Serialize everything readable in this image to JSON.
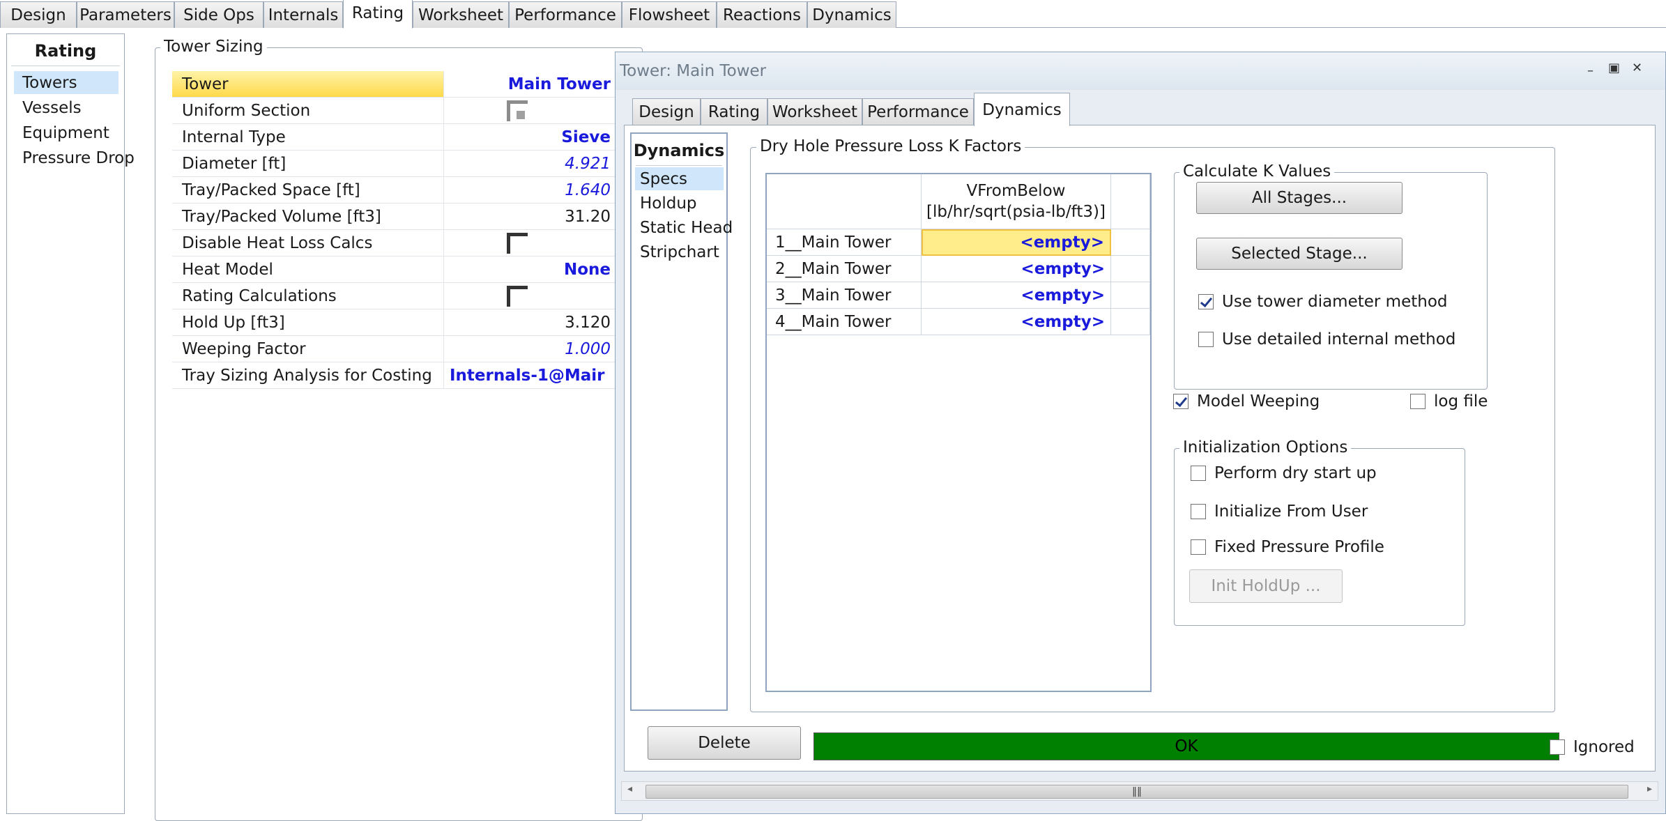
{
  "top_tabs": [
    "Design",
    "Parameters",
    "Side Ops",
    "Internals",
    "Rating",
    "Worksheet",
    "Performance",
    "Flowsheet",
    "Reactions",
    "Dynamics"
  ],
  "active_top_tab": "Rating",
  "left_nav": {
    "title": "Rating",
    "items": [
      "Towers",
      "Vessels",
      "Equipment",
      "Pressure Drop"
    ],
    "selected": "Towers"
  },
  "tower_sizing": {
    "title": "Tower Sizing",
    "rows": [
      {
        "label": "Tower",
        "value": "Main Tower"
      },
      {
        "label": "Uniform Section",
        "value": ""
      },
      {
        "label": "Internal Type",
        "value": "Sieve"
      },
      {
        "label": "Diameter [ft]",
        "value": "4.921"
      },
      {
        "label": "Tray/Packed Space [ft]",
        "value": "1.640"
      },
      {
        "label": "Tray/Packed Volume [ft3]",
        "value": "31.20"
      },
      {
        "label": "Disable Heat Loss Calcs",
        "value": ""
      },
      {
        "label": "Heat Model",
        "value": "None"
      },
      {
        "label": "Rating Calculations",
        "value": ""
      },
      {
        "label": "Hold Up [ft3]",
        "value": "3.120"
      },
      {
        "label": "Weeping Factor",
        "value": "1.000"
      },
      {
        "label": "Tray Sizing Analysis for Costing",
        "value": "Internals-1@Mair"
      }
    ]
  },
  "subwindow": {
    "title": "Tower: Main Tower",
    "tabs": [
      "Design",
      "Rating",
      "Worksheet",
      "Performance",
      "Dynamics"
    ],
    "active_tab": "Dynamics",
    "dyn_nav": {
      "title": "Dynamics",
      "items": [
        "Specs",
        "Holdup",
        "Static Head",
        "Stripchart"
      ],
      "selected": "Specs"
    },
    "kfactors": {
      "group_title": "Dry Hole Pressure Loss K Factors",
      "column_header_line1": "VFromBelow",
      "column_header_line2": "[lb/hr/sqrt(psia-lb/ft3)]",
      "rows": [
        {
          "stage": "1__Main Tower",
          "value": "<empty>"
        },
        {
          "stage": "2__Main Tower",
          "value": "<empty>"
        },
        {
          "stage": "3__Main Tower",
          "value": "<empty>"
        },
        {
          "stage": "4__Main Tower",
          "value": "<empty>"
        }
      ]
    },
    "calc_k": {
      "title": "Calculate K Values",
      "all_stages_label": "All Stages...",
      "selected_stage_label": "Selected Stage...",
      "use_tower_diameter_label": "Use tower diameter method",
      "use_tower_diameter_checked": true,
      "use_detailed_internal_label": "Use detailed internal method",
      "use_detailed_internal_checked": false
    },
    "model_weeping_label": "Model Weeping",
    "model_weeping_checked": true,
    "log_file_label": "log file",
    "log_file_checked": false,
    "init_options": {
      "title": "Initialization Options",
      "perform_dry_label": "Perform dry start up",
      "init_from_user_label": "Initialize From User",
      "fixed_pressure_label": "Fixed Pressure Profile",
      "init_holdup_label": "Init HoldUp ..."
    },
    "delete_label": "Delete",
    "status_text": "OK",
    "ignored_label": "Ignored",
    "ignored_checked": false
  },
  "colors": {
    "status_green": "#008000",
    "highlight_yellow": "#ffd94a",
    "value_blue": "#1a1adc",
    "selection_blue": "#cfe6fb"
  }
}
